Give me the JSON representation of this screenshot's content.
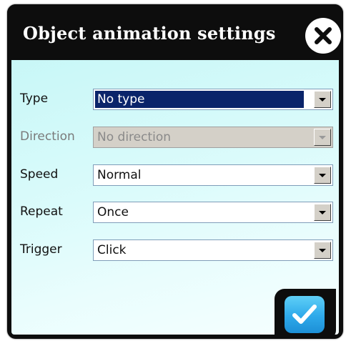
{
  "dialog": {
    "title": "Object animation settings",
    "close_label": "close"
  },
  "fields": [
    {
      "label": "Type",
      "value": "No type",
      "state": "selected"
    },
    {
      "label": "Direction",
      "value": "No direction",
      "state": "disabled"
    },
    {
      "label": "Speed",
      "value": "Normal",
      "state": "normal"
    },
    {
      "label": "Repeat",
      "value": "Once",
      "state": "normal"
    },
    {
      "label": "Trigger",
      "value": "Click",
      "state": "normal"
    }
  ],
  "colors": {
    "titlebar": "#0d0d0d",
    "panel": "#c8f7f7",
    "selection": "#0a246a",
    "ok_button": "#2ea9ea"
  },
  "icons": {
    "close": "close-icon",
    "confirm": "checkmark-icon",
    "dropdown": "chevron-down-icon"
  }
}
